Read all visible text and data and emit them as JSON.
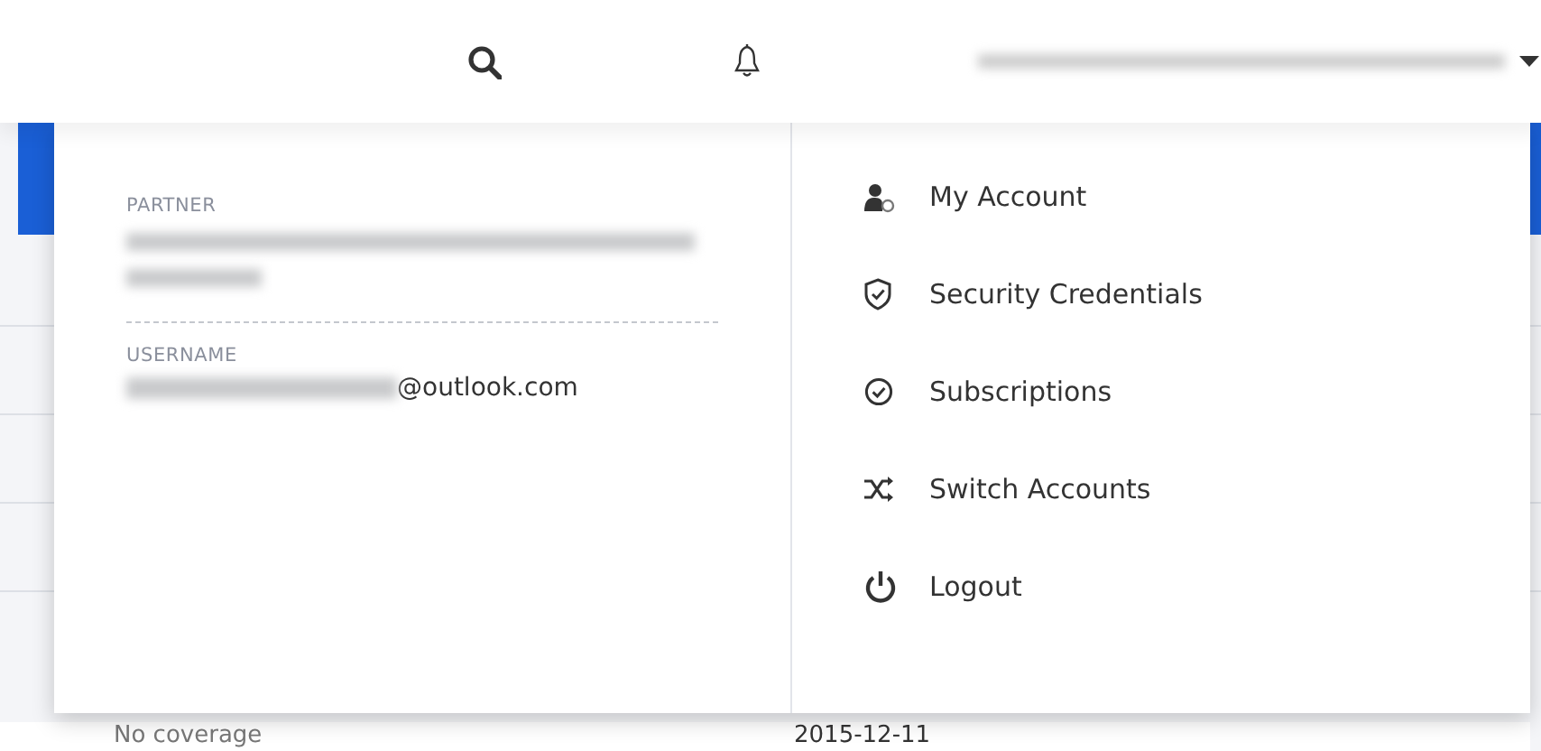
{
  "top_bar": {
    "account_menu": {
      "expanded": true
    }
  },
  "account_panel": {
    "partner": {
      "label": "PARTNER"
    },
    "username": {
      "label": "USERNAME",
      "domain": "@outlook.com"
    }
  },
  "menu": [
    {
      "kind": "user",
      "label": "My Account"
    },
    {
      "kind": "shield",
      "label": "Security Credentials"
    },
    {
      "kind": "check",
      "label": "Subscriptions"
    },
    {
      "kind": "shuffle",
      "label": "Switch Accounts"
    },
    {
      "kind": "power",
      "label": "Logout"
    }
  ],
  "table_row": {
    "cells": [
      "No coverage",
      "2015-12-11"
    ]
  }
}
